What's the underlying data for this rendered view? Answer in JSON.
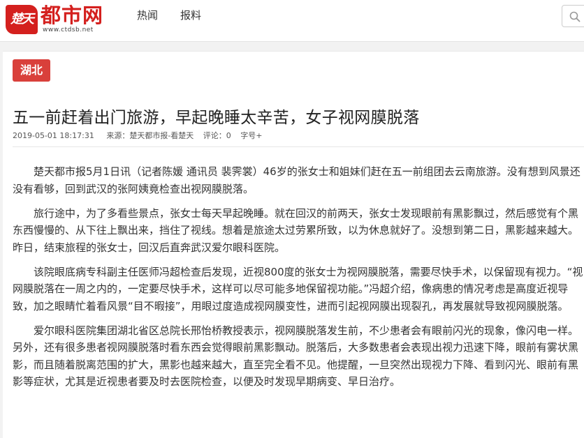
{
  "header": {
    "logo_badge": "楚天",
    "logo_name": "都市网",
    "logo_url": "www.ctdsb.net",
    "nav": [
      {
        "label": "热闻"
      },
      {
        "label": "报料"
      }
    ],
    "brand_color": "#d4201e"
  },
  "article": {
    "tag": "湖北",
    "title": "五一前赶着出门旅游，早起晚睡太辛苦，女子视网膜脱落",
    "meta": {
      "datetime": "2019-05-01 18:17:31",
      "source": "来源：楚天都市报-看楚天",
      "comments": "评论：0",
      "font_size": "字号+"
    },
    "paragraphs": [
      "楚天都市报5月1日讯（记者陈媛  通讯员  裴霁裳）46岁的张女士和姐妹们赶在五一前组团去云南旅游。没有想到风景还没有看够，回到武汉的张阿姨竟检查出视网膜脱落。",
      "旅行途中，为了多看些景点，张女士每天早起晚睡。就在回汉的前两天，张女士发现眼前有黑影飘过，然后感觉有个黑东西慢慢的、从下往上飘出来，挡住了视线。想着是旅途太过劳累所致，以为休息就好了。没想到第二日，黑影越来越大。昨日，结束旅程的张女士，回汉后直奔武汉爱尔眼科医院。",
      "该院眼底病专科副主任医师冯超检查后发现，近视800度的张女士为视网膜脱落，需要尽快手术，以保留现有视力。“视网膜脱落在一周之内的，一定要尽快手术，这样可以尽可能多地保留视功能。”冯超介绍，像病患的情况考虑是高度近视导致，加之眼睛忙着看风景“目不暇接”，用眼过度造成视网膜变性，进而引起视网膜出现裂孔，再发展就导致视网膜脱落。",
      "爱尔眼科医院集团湖北省区总院长邢怡桥教授表示，视网膜脱落发生前，不少患者会有眼前闪光的现象，像闪电一样。另外，还有很多患者视网膜脱落时看东西会觉得眼前黑影飘动。脱落后，大多数患者会表现出视力迅速下降，眼前有雾状黑影，而且随着脱离范围的扩大，黑影也越来越大，直至完全看不见。他提醒，一旦突然出现视力下降、看到闪光、眼前有黑影等症状，尤其是近视患者要及时去医院检查，以便及时发现早期病变、早日治疗。"
    ]
  }
}
